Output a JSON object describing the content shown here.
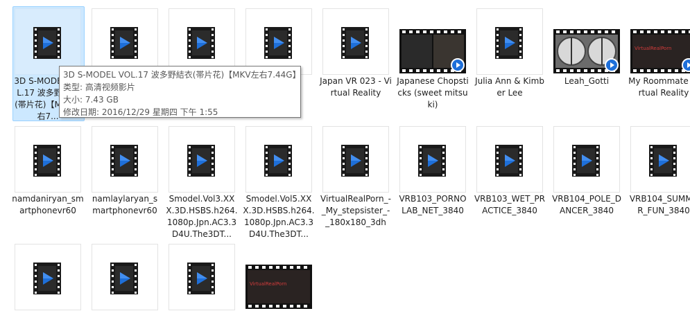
{
  "items": [
    {
      "label": "3D S-MODEL VOL.17 波多野結衣(帯片花)【MKV左右7...",
      "kind": "icon",
      "selected": true
    },
    {
      "label": "",
      "kind": "icon"
    },
    {
      "label": "",
      "kind": "icon"
    },
    {
      "label": "y",
      "kind": "icon"
    },
    {
      "label": "Japan VR 023 - Virtual Reality",
      "kind": "icon"
    },
    {
      "label": "Japanese Chopsticks (sweet mitsuki)",
      "kind": "video"
    },
    {
      "label": "Julia Ann & Kimber Lee",
      "kind": "icon"
    },
    {
      "label": "Leah_Gotti",
      "kind": "video-helmets"
    },
    {
      "label": "My Roommate Virtual Reality",
      "kind": "video-red"
    },
    {
      "label": "namdaniryan_smartphonevr60",
      "kind": "icon"
    },
    {
      "label": "namlaylaryan_smartphonevr60",
      "kind": "icon"
    },
    {
      "label": "Smodel.Vol3.XXX.3D.HSBS.h264.1080p.Jpn.AC3.3D4U.The3DT...",
      "kind": "icon"
    },
    {
      "label": "Smodel.Vol5.XXX.3D.HSBS.h264.1080p.Jpn.AC3.3D4U.The3DT...",
      "kind": "icon"
    },
    {
      "label": "VirtualRealPorn_-_My_stepsister_-_180x180_3dh",
      "kind": "icon"
    },
    {
      "label": "VRB103_PORNOLAB_NET_3840",
      "kind": "icon"
    },
    {
      "label": "VRB103_WET_PRACTICE_3840",
      "kind": "icon"
    },
    {
      "label": "VRB104_POLE_DANCER_3840",
      "kind": "icon"
    },
    {
      "label": "VRB104_SUMMER_FUN_3840",
      "kind": "icon"
    },
    {
      "label": "",
      "kind": "icon"
    },
    {
      "label": "",
      "kind": "icon"
    },
    {
      "label": "",
      "kind": "icon"
    },
    {
      "label": "",
      "kind": "video-red"
    }
  ],
  "tooltip": {
    "title": "3D S-MODEL VOL.17 波多野結衣(帯片花)【MKV左右7.44G】",
    "type_line": "类型: 高清视频影片",
    "size_line": "大小: 7.43 GB",
    "date_line": "修改日期: 2016/12/29 星期四 下午 1:55"
  },
  "thumb_texts": {
    "red_brand": "VirtualRealPorn"
  },
  "colors": {
    "selection_bg": "#cce8ff",
    "play_blue": "#1e6fd9",
    "film_black": "#1a1a1a"
  },
  "icons": {
    "video_file": "video-file-icon",
    "play_badge": "play-badge-icon"
  }
}
